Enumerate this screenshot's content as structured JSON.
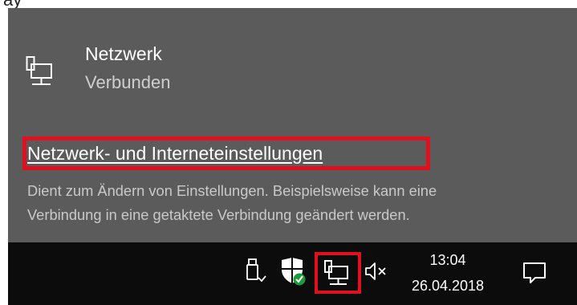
{
  "page_top": {
    "partial_text": "ay"
  },
  "flyout": {
    "network_name": "Netzwerk",
    "network_status": "Verbunden",
    "settings_link": "Netzwerk- und Interneteinstellungen",
    "description_line1": "Dient zum Ändern von Einstellungen. Beispielsweise kann eine",
    "description_line2": "Verbindung in eine getaktete Verbindung geändert werden."
  },
  "taskbar": {
    "time": "13:04",
    "date": "26.04.2018",
    "icons": [
      "usb-icon",
      "shield-icon",
      "network-icon",
      "speaker-muted-icon",
      "notification-icon"
    ]
  },
  "colors": {
    "flyout_bg": "#5b5b5b",
    "taskbar_bg": "#0c0c0c",
    "highlight": "#e0101e",
    "text_secondary": "#c9c9c9"
  }
}
